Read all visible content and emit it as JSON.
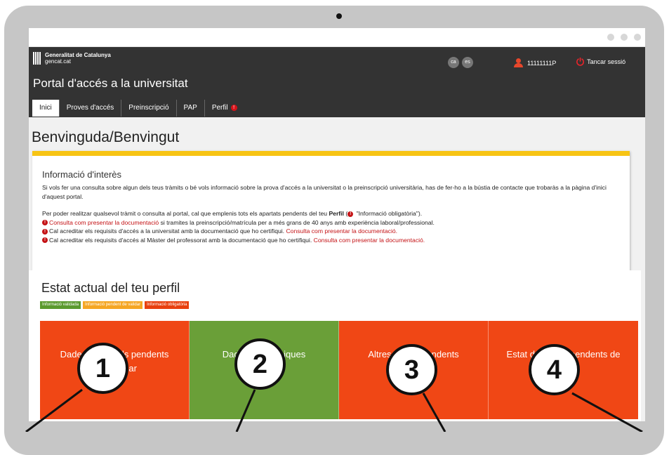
{
  "header": {
    "gen_line1": "Generalitat de Catalunya",
    "gen_line2": "gencat.cat",
    "langs": [
      "ca",
      "es"
    ],
    "user_id": "11111111P",
    "logout_label": "Tancar sessió",
    "portal_title": "Portal d'accés a la universitat"
  },
  "tabs": [
    {
      "label": "Inici",
      "active": true
    },
    {
      "label": "Proves d'accés"
    },
    {
      "label": "Preinscripció"
    },
    {
      "label": "PAP"
    },
    {
      "label": "Perfil",
      "badge": "!"
    }
  ],
  "welcome": "Benvinguda/Benvingut",
  "info": {
    "title": "Informació d'interès",
    "p1": "Si vols fer una consulta sobre algun dels teus tràmits o bé vols informació sobre la prova d'accés a la universitat o la preinscripció universitària, has de fer-ho a la bústia de contacte que trobaràs a la pàgina d'inici d'aquest portal.",
    "p2_a": "Per poder realitzar qualsevol tràmit o consulta al portal, cal que emplenis tots els apartats pendents del teu ",
    "p2_b": "Perfil",
    "p2_c": " (",
    "p2_d": " \"Informació obligatòria\").",
    "b1_link": "Consulta com presentar la documentació",
    "b1_text": " si tramites la preinscripció/matrícula per a més grans de 40 anys amb experiència laboral/professional.",
    "b2_text": "Cal acreditar els requisits d'accés a la universitat amb la documentació que ho certifiqui. ",
    "b2_link": "Consulta com presentar la documentació.",
    "b3_text": "Cal acreditar els requisits d'accés al Màster del professorat amb la documentació que ho certifiqui. ",
    "b3_link": "Consulta com presentar la documentació."
  },
  "estat": {
    "title": "Estat actual del teu perfil",
    "legend": [
      {
        "label": "Informació validada",
        "color": "#5b9a2e"
      },
      {
        "label": "Informació pendent de validar",
        "color": "#f5a623"
      },
      {
        "label": "Informació obligatòria",
        "color": "#e8400f"
      }
    ],
    "cards": [
      {
        "text": "Dades personals pendents d'emplenar",
        "color": "#f04715",
        "number": "1"
      },
      {
        "text": "Dades acadèmiques",
        "color": "#6a9f38",
        "number": "2"
      },
      {
        "text": "Altres dades pendents",
        "color": "#f04715",
        "number": "3"
      },
      {
        "text": "Estat de dades pendents de validar",
        "color": "#f04715",
        "number": "4"
      }
    ]
  },
  "colors": {
    "topbar": "#333333",
    "accent_yellow": "#f7c414",
    "alert_red": "#c41215"
  }
}
